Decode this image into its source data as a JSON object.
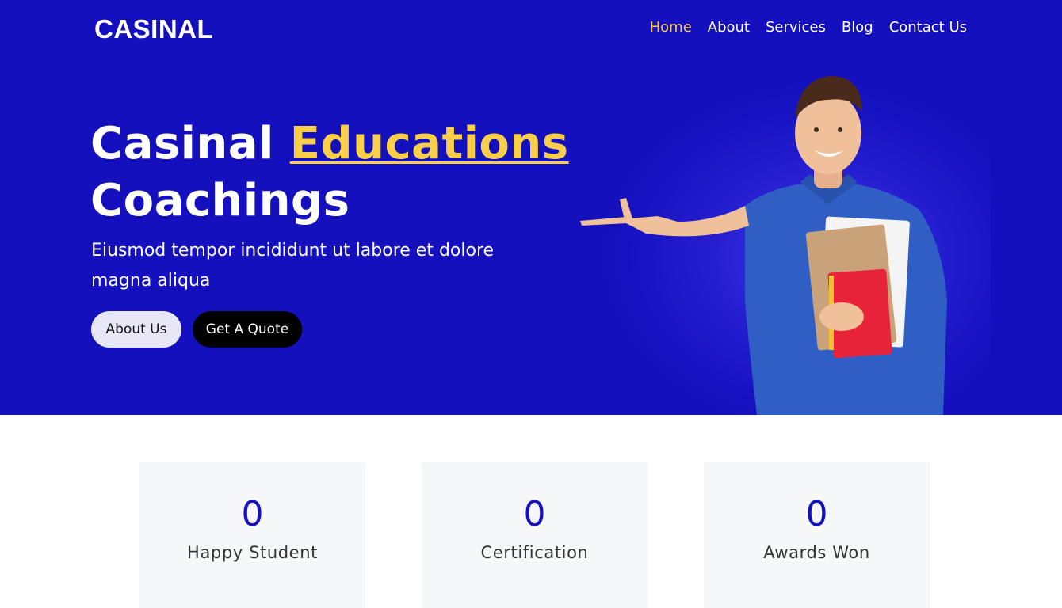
{
  "brand": {
    "logo": "CASINAL"
  },
  "nav": {
    "items": [
      {
        "label": "Home",
        "active": true
      },
      {
        "label": "About",
        "active": false
      },
      {
        "label": "Services",
        "active": false
      },
      {
        "label": "Blog",
        "active": false
      },
      {
        "label": "Contact Us",
        "active": false
      }
    ]
  },
  "hero": {
    "title_part1": "Casinal ",
    "title_accent": "Educations",
    "title_part2": "Coachings",
    "subtitle": "Eiusmod tempor incididunt ut labore et dolore magna aliqua",
    "btn_about": "About Us",
    "btn_quote": "Get A Quote"
  },
  "stats": [
    {
      "value": "0",
      "label": "Happy Student"
    },
    {
      "value": "0",
      "label": "Certification"
    },
    {
      "value": "0",
      "label": "Awards Won"
    }
  ],
  "colors": {
    "hero_bg": "#1410bd",
    "accent": "#f9cf4a",
    "nav_active": "#f9c74f",
    "stat_number": "#1410bd"
  }
}
